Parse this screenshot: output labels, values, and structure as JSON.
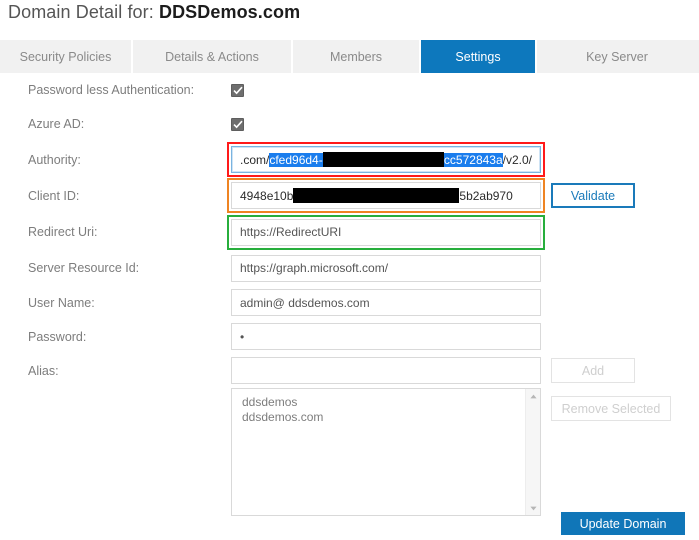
{
  "header": {
    "title_prefix": "Domain Detail for:",
    "domain": "DDSDemos.com"
  },
  "tabs": [
    {
      "label": "Security Policies",
      "active": false
    },
    {
      "label": "Details & Actions",
      "active": false
    },
    {
      "label": "Members",
      "active": false
    },
    {
      "label": "Settings",
      "active": true
    },
    {
      "label": "Key Server",
      "active": false
    }
  ],
  "form": {
    "password_less_auth": {
      "label": "Password less Authentication:",
      "checked": true
    },
    "azure_ad": {
      "label": "Azure AD:",
      "checked": true
    },
    "authority": {
      "label": "Authority:",
      "text_before": ".com/",
      "selected_start": "cfed96d4-",
      "selected_end": "cc572843a",
      "text_after": "/v2.0/"
    },
    "client_id": {
      "label": "Client ID:",
      "text_before": "4948e10b",
      "text_after": "5b2ab970"
    },
    "redirect_uri": {
      "label": "Redirect Uri:",
      "value": "https://RedirectURI"
    },
    "server_resource_id": {
      "label": "Server Resource Id:",
      "value": "https://graph.microsoft.com/"
    },
    "user_name": {
      "label": "User Name:",
      "value": "admin@ ddsdemos.com"
    },
    "password": {
      "label": "Password:",
      "value": "•"
    },
    "alias": {
      "label": "Alias:",
      "value": "",
      "placeholder": ""
    }
  },
  "buttons": {
    "validate": "Validate",
    "add": "Add",
    "remove_selected": "Remove Selected",
    "update_domain": "Update Domain"
  },
  "alias_list": [
    "ddsdemos",
    "ddsdemos.com"
  ],
  "colors": {
    "accent_blue": "#0d78bd",
    "button_blue": "#1076b8",
    "validate_border": "#1a7aba",
    "annotation_red": "#ff1a1a",
    "annotation_orange": "#ef8423",
    "annotation_green": "#27ae3c",
    "selection_blue": "#1a7ded",
    "tabbar_bg": "#f1f1f1",
    "label_gray": "#7d7d7d"
  }
}
